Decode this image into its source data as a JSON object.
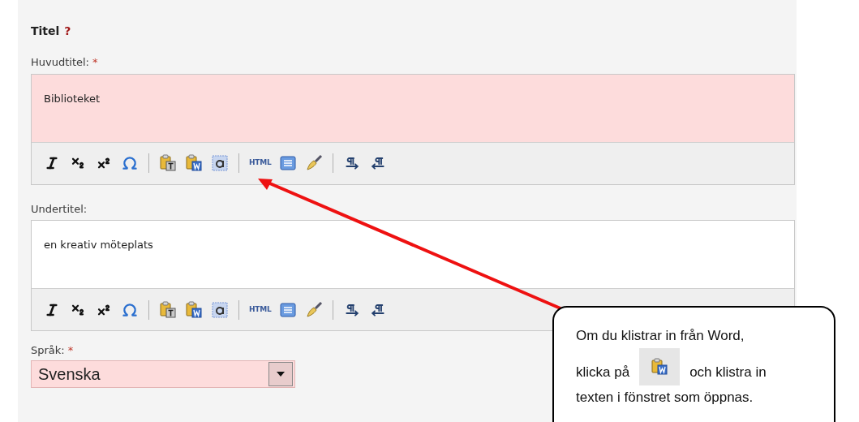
{
  "section": {
    "title": "Titel",
    "help": "?"
  },
  "editors": [
    {
      "label": "Huvudtitel:",
      "required": true,
      "value": "Biblioteket",
      "invalid": true,
      "toolbar": [
        {
          "kind": "italic"
        },
        {
          "kind": "subscript"
        },
        {
          "kind": "superscript"
        },
        {
          "kind": "omega"
        },
        {
          "kind": "sep"
        },
        {
          "kind": "paste-text"
        },
        {
          "kind": "paste-word"
        },
        {
          "kind": "select-all"
        },
        {
          "kind": "sep"
        },
        {
          "kind": "html",
          "label": "HTML"
        },
        {
          "kind": "template"
        },
        {
          "kind": "clean"
        },
        {
          "kind": "sep"
        },
        {
          "kind": "ltr"
        },
        {
          "kind": "rtl"
        }
      ]
    },
    {
      "label": "Undertitel:",
      "required": false,
      "value": "en kreativ möteplats",
      "invalid": false,
      "toolbar": [
        {
          "kind": "italic"
        },
        {
          "kind": "subscript"
        },
        {
          "kind": "superscript"
        },
        {
          "kind": "omega"
        },
        {
          "kind": "sep"
        },
        {
          "kind": "paste-text"
        },
        {
          "kind": "paste-word"
        },
        {
          "kind": "select-all"
        },
        {
          "kind": "sep"
        },
        {
          "kind": "html",
          "label": "HTML"
        },
        {
          "kind": "template"
        },
        {
          "kind": "clean"
        },
        {
          "kind": "sep"
        },
        {
          "kind": "ltr"
        },
        {
          "kind": "rtl"
        }
      ]
    }
  ],
  "language": {
    "label": "Språk:",
    "required": true,
    "value": "Svenska",
    "invalid": true
  },
  "required_mark": "*",
  "callout": {
    "line1": "Om du klistrar in från Word,",
    "line2_before": "klicka på",
    "line2_after": "och klistra in",
    "line3": "texten i fönstret som öppnas."
  }
}
